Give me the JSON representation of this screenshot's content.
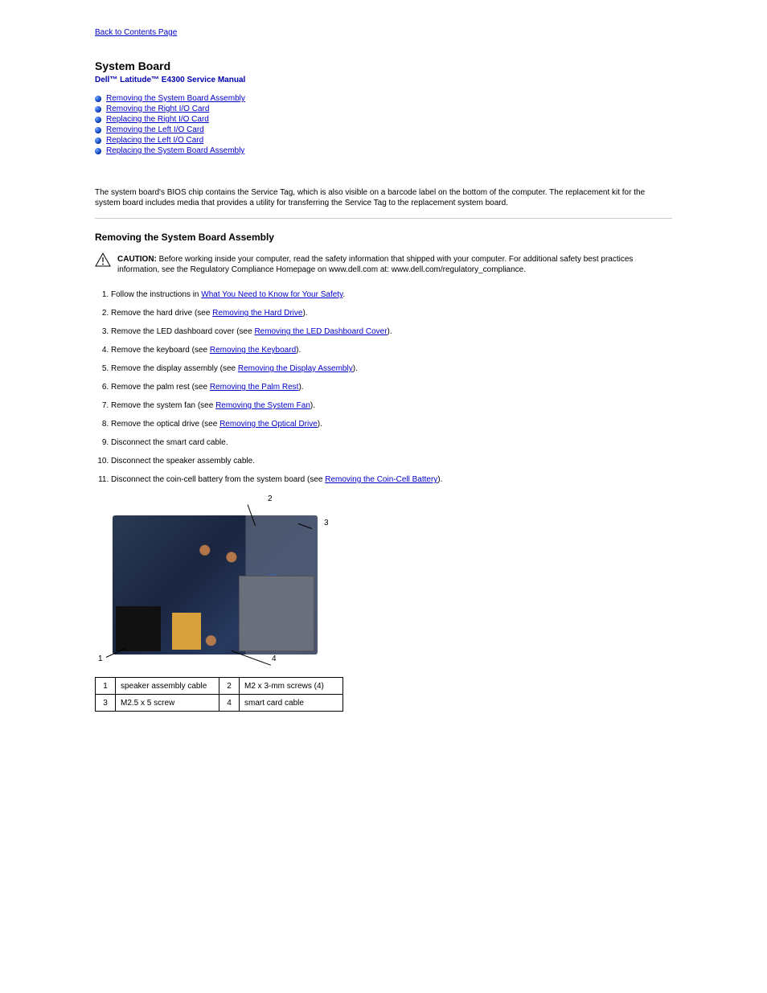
{
  "nav": {
    "back_label": "Back to Contents Page"
  },
  "header": {
    "page_title": "System Board",
    "manual_name": "Dell™ Latitude™ E4300 Service Manual"
  },
  "toc": [
    {
      "label": "Removing the System Board Assembly"
    },
    {
      "label": "Removing the Right I/O Card"
    },
    {
      "label": "Replacing the Right I/O Card"
    },
    {
      "label": "Removing the Left I/O Card"
    },
    {
      "label": "Replacing the Left I/O Card"
    },
    {
      "label": "Replacing the System Board Assembly"
    }
  ],
  "intro": "The system board's BIOS chip contains the Service Tag, which is also visible on a barcode label on the bottom of the computer. The replacement kit for the system board includes media that provides a utility for transferring the Service Tag to the replacement system board.",
  "section": {
    "title": "Removing the System Board Assembly"
  },
  "caution": {
    "label": "CAUTION:",
    "text": " Before working inside your computer, read the safety information that shipped with your computer. For additional safety best practices information, see the Regulatory Compliance Homepage on www.dell.com at: www.dell.com/regulatory_compliance."
  },
  "steps": [
    {
      "pre": "Follow the instructions in ",
      "link": "What You Need to Know for Your Safety",
      "post": "."
    },
    {
      "pre": "Remove the hard drive (see ",
      "link": "Removing the Hard Drive",
      "post": ")."
    },
    {
      "pre": "Remove the LED dashboard cover (see ",
      "link": "Removing the LED Dashboard Cover",
      "post": ")."
    },
    {
      "pre": "Remove the keyboard (see ",
      "link": "Removing the Keyboard",
      "post": ")."
    },
    {
      "pre": "Remove the display assembly (see ",
      "link": "Removing the Display Assembly",
      "post": ")."
    },
    {
      "pre": "Remove the palm rest (see ",
      "link": "Removing the Palm Rest",
      "post": ")."
    },
    {
      "pre": "Remove the system fan (see ",
      "link": "Removing the System Fan",
      "post": ")."
    },
    {
      "pre": "Remove the optical drive (see ",
      "link": "Removing the Optical Drive",
      "post": ")."
    },
    {
      "pre": "Disconnect the smart card cable.",
      "link": "",
      "post": ""
    },
    {
      "pre": "Disconnect the speaker assembly cable.",
      "link": "",
      "post": ""
    },
    {
      "pre": "Disconnect the coin-cell battery from the system board (see ",
      "link": "Removing the Coin-Cell Battery",
      "post": ")."
    }
  ],
  "labels_table": [
    {
      "n": "1",
      "t": "speaker assembly cable"
    },
    {
      "n": "2",
      "t": "M2 x 3-mm screws (4)"
    },
    {
      "n": "3",
      "t": "M2.5 x 5 screw"
    },
    {
      "n": "4",
      "t": "smart card cable"
    }
  ]
}
